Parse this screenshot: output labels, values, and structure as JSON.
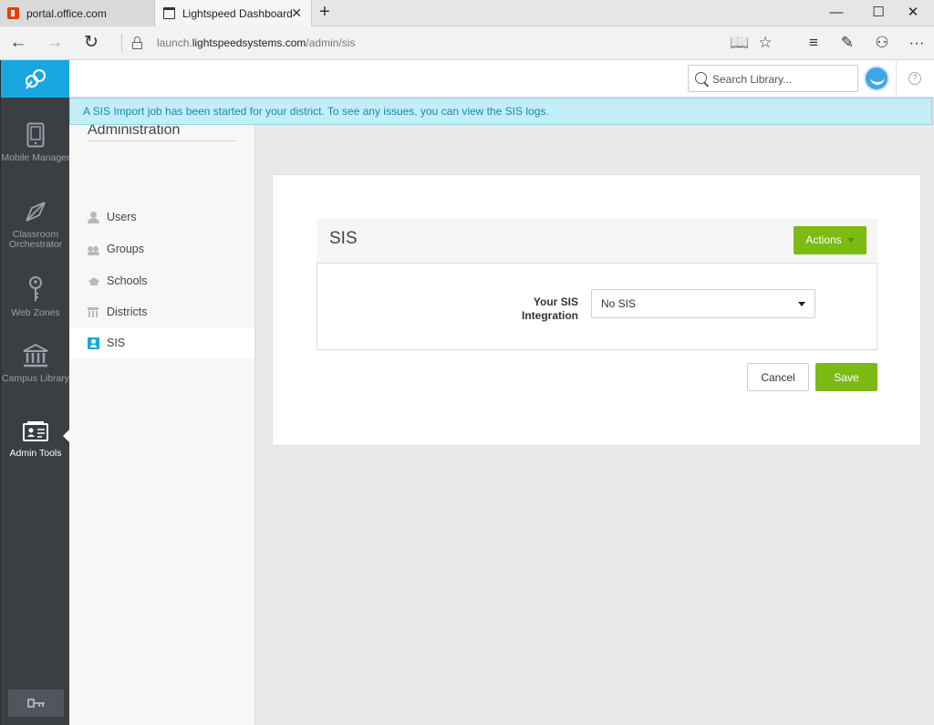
{
  "browser": {
    "tabs": [
      {
        "title": "portal.office.com",
        "active": false,
        "icon": "office-favicon-icon"
      },
      {
        "title": "Lightspeed Dashboard",
        "active": true,
        "icon": "page-favicon-icon"
      }
    ],
    "new_tab_glyph": "+",
    "tab_close_glyph": "✕",
    "window_controls": {
      "minimize": "—",
      "maximize": "☐",
      "close": "✕"
    },
    "nav": {
      "back": "←",
      "forward": "→",
      "refresh": "↻"
    },
    "url": {
      "prefix": "launch.",
      "domain": "lightspeedsystems.com",
      "path": "/admin/sis"
    },
    "toolbar": {
      "reading_view": "📖",
      "favorite": "☆",
      "hub": "≡",
      "note": "✎",
      "share": "⚇",
      "more": "···"
    }
  },
  "app": {
    "left_nav": [
      {
        "label": "Mobile Manager",
        "icon": "mobile-device-icon",
        "active": false
      },
      {
        "label": "Classroom Orchestrator",
        "icon": "compass-icon",
        "active": false
      },
      {
        "label": "Web Zones",
        "icon": "key-icon",
        "active": false
      },
      {
        "label": "Campus Library",
        "icon": "library-building-icon",
        "active": false
      },
      {
        "label": "Admin Tools",
        "icon": "admin-card-icon",
        "active": true
      }
    ],
    "search": {
      "placeholder": "Search Library..."
    },
    "help_glyph": "?",
    "banner": "A SIS Import job has been started for your district. To see any issues, you can view the SIS logs.",
    "sidebar": {
      "title": "Administration",
      "items": [
        {
          "label": "Users",
          "icon": "user-icon",
          "active": false
        },
        {
          "label": "Groups",
          "icon": "group-icon",
          "active": false
        },
        {
          "label": "Schools",
          "icon": "school-icon",
          "active": false
        },
        {
          "label": "Districts",
          "icon": "district-icon",
          "active": false
        },
        {
          "label": "SIS",
          "icon": "sis-icon",
          "active": true
        }
      ]
    },
    "panel": {
      "title": "SIS",
      "actions_label": "Actions",
      "field_label": "Your SIS Integration",
      "field_value": "No SIS",
      "cancel_label": "Cancel",
      "save_label": "Save"
    }
  },
  "colors": {
    "accent_blue": "#1aa7e0",
    "accent_green": "#7cbb14",
    "nav_dark": "#3a3f44",
    "banner_bg": "#c4eef7",
    "banner_text": "#138ab0"
  }
}
